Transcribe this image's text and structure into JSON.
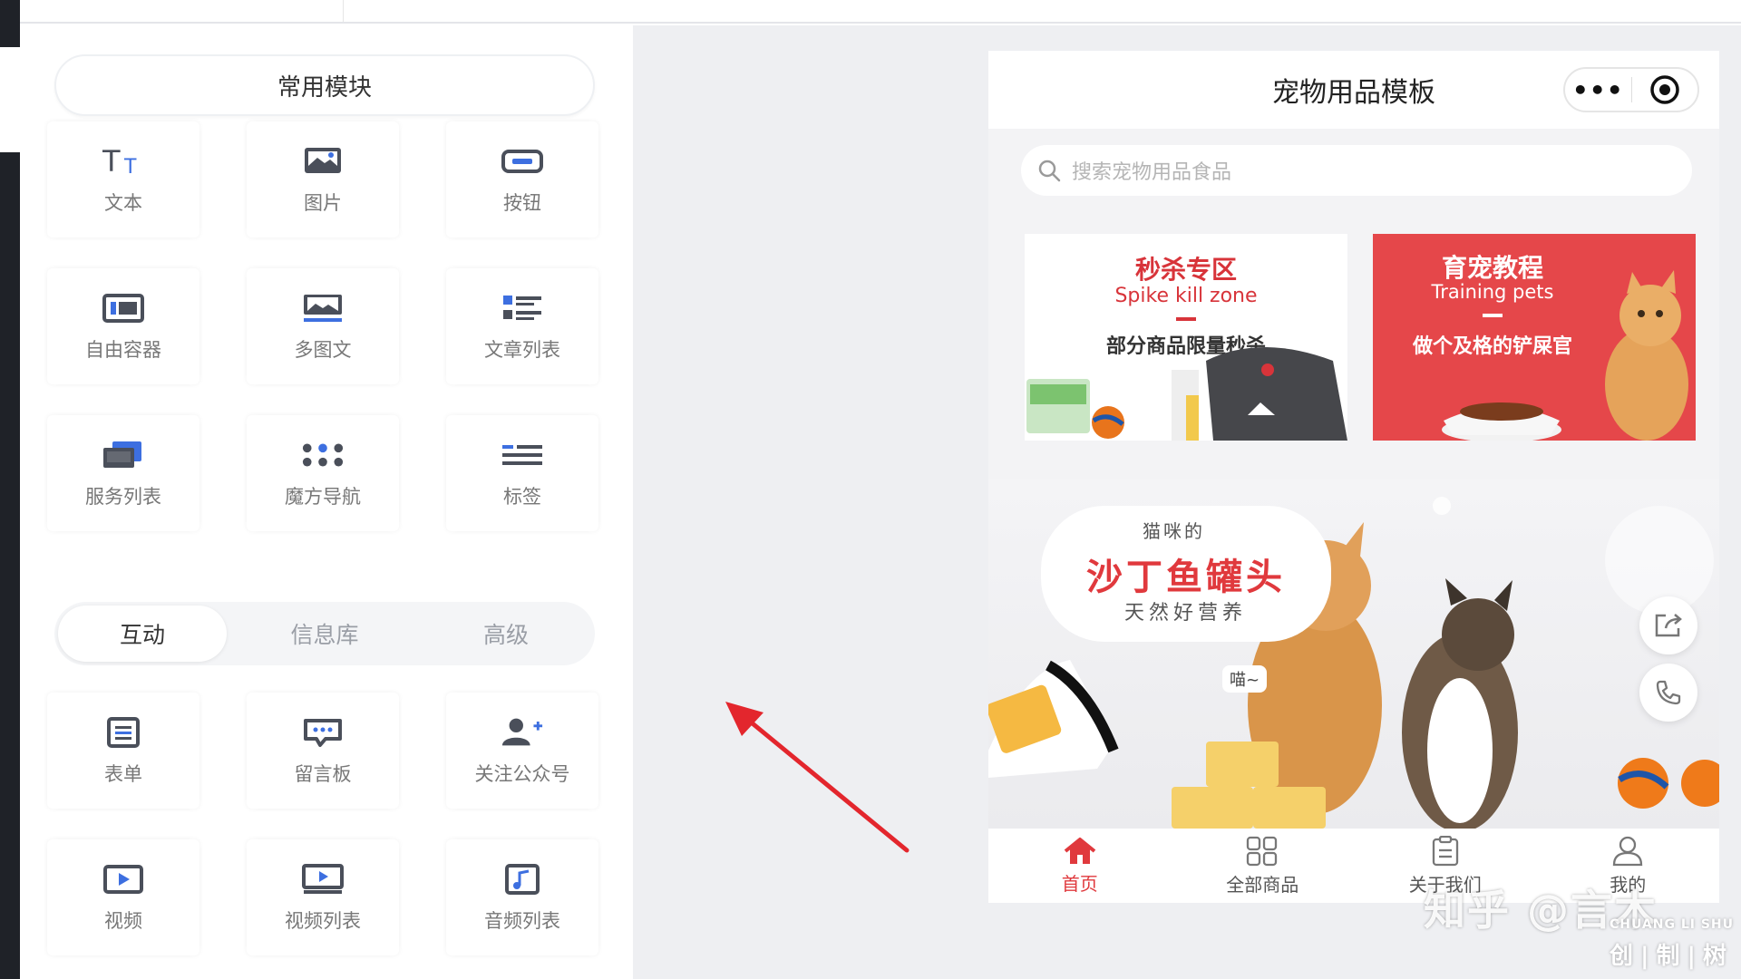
{
  "component_panel": {
    "common_header": "常用模块",
    "common_items": [
      {
        "label": "文本",
        "icon": "text-icon"
      },
      {
        "label": "图片",
        "icon": "image-icon"
      },
      {
        "label": "按钮",
        "icon": "button-icon"
      },
      {
        "label": "自由容器",
        "icon": "container-icon"
      },
      {
        "label": "多图文",
        "icon": "multi-image-text-icon"
      },
      {
        "label": "文章列表",
        "icon": "article-list-icon"
      },
      {
        "label": "服务列表",
        "icon": "service-list-icon"
      },
      {
        "label": "魔方导航",
        "icon": "cube-nav-icon"
      },
      {
        "label": "标签",
        "icon": "tag-icon"
      }
    ],
    "tabs": [
      {
        "label": "互动",
        "active": true
      },
      {
        "label": "信息库",
        "active": false
      },
      {
        "label": "高级",
        "active": false
      }
    ],
    "interactive_items": [
      {
        "label": "表单",
        "icon": "form-icon"
      },
      {
        "label": "留言板",
        "icon": "message-board-icon"
      },
      {
        "label": "关注公众号",
        "icon": "follow-account-icon"
      },
      {
        "label": "视频",
        "icon": "video-icon"
      },
      {
        "label": "视频列表",
        "icon": "video-list-icon"
      },
      {
        "label": "音频列表",
        "icon": "audio-list-icon"
      }
    ]
  },
  "preview": {
    "title": "宠物用品模板",
    "capsule_more": "•••",
    "search_placeholder": "搜索宠物用品食品",
    "banner_left": {
      "title": "秒杀专区",
      "subtitle_en": "Spike kill zone",
      "tagline": "部分商品限量秒杀"
    },
    "banner_right": {
      "title": "育宠教程",
      "subtitle_en": "Training pets",
      "tagline": "做个及格的铲屎官"
    },
    "hero": {
      "small": "猫咪的",
      "main": "沙丁鱼罐头",
      "sub": "天然好营养",
      "meow": "喵~"
    },
    "tabbar": [
      {
        "label": "首页",
        "icon": "home-icon",
        "active": true
      },
      {
        "label": "全部商品",
        "icon": "all-products-icon",
        "active": false
      },
      {
        "label": "关于我们",
        "icon": "about-us-icon",
        "active": false
      },
      {
        "label": "我的",
        "icon": "profile-icon",
        "active": false
      }
    ]
  },
  "colors": {
    "accent_red": "#e0393d",
    "icon_dark": "#4a4f5a",
    "icon_blue": "#3d6fe0",
    "canvas_bg": "#eeeff2"
  },
  "watermark": {
    "text": "知乎 @言木",
    "logo_en": "CHUANG LI SHU",
    "logo_cn": "创|制|树"
  }
}
